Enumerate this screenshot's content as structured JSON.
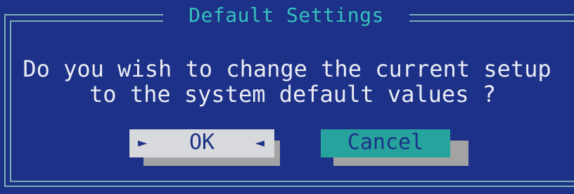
{
  "dialog": {
    "title": "Default Settings",
    "message_line1": "Do you wish to change the current setup",
    "message_line2": "to the system default values ?",
    "ok_label": "OK",
    "cancel_label": "Cancel",
    "ok_arrow_left": "►",
    "ok_arrow_right": "◄"
  },
  "colors": {
    "background": "#1d3188",
    "frame": "#78aeb4",
    "title": "#36c2bd",
    "text": "#e9ecf4",
    "ok_button": "#d7d9dc",
    "cancel_button": "#27a39d",
    "button_shadow": "#a3a3a3"
  }
}
